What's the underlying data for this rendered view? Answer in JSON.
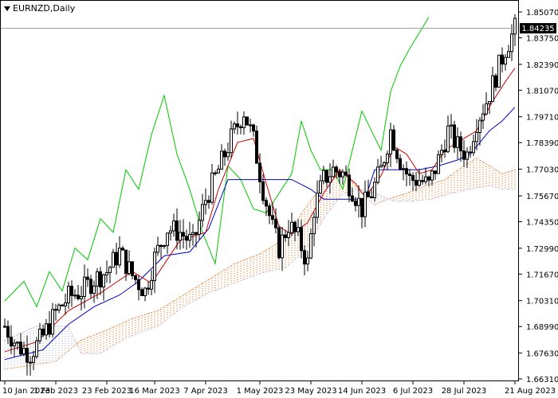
{
  "header": {
    "symbol_label": "EURNZD,Daily"
  },
  "colors": {
    "background": "#ffffff",
    "candle": "#000000",
    "chikou": "#00c800",
    "tenkan": "#cc0000",
    "kijun": "#0000cc",
    "cloud_bull": "#e06000",
    "cloud_bear": "#a0a0c8",
    "price_line": "#a0a0a0"
  },
  "chart_data": {
    "type": "candlestick",
    "title": "EURNZD,Daily",
    "current_price": 1.84235,
    "current_price_label": "1.84235",
    "ylim": [
      1.6631,
      1.8507
    ],
    "y_ticks": [
      "1.85070",
      "1.83750",
      "1.82390",
      "1.81070",
      "1.79710",
      "1.78390",
      "1.77030",
      "1.75670",
      "1.74350",
      "1.72990",
      "1.71670",
      "1.70310",
      "1.68990",
      "1.67630",
      "1.66310"
    ],
    "x_tick_labels": [
      "10 Jan 2023",
      "1 Feb 2023",
      "23 Feb 2023",
      "16 Mar 2023",
      "7 Apr 2023",
      "1 May 2023",
      "23 May 2023",
      "14 Jun 2023",
      "6 Jul 2023",
      "28 Jul 2023",
      "21 Aug 2023"
    ],
    "x_tick_index": [
      0,
      16,
      32,
      47,
      63,
      80,
      96,
      112,
      128,
      144,
      160
    ],
    "close_anchors": [
      [
        0,
        1.69
      ],
      [
        4,
        1.68
      ],
      [
        8,
        1.676
      ],
      [
        12,
        1.685
      ],
      [
        16,
        1.697
      ],
      [
        20,
        1.705
      ],
      [
        24,
        1.708
      ],
      [
        28,
        1.714
      ],
      [
        32,
        1.718
      ],
      [
        36,
        1.728
      ],
      [
        40,
        1.716
      ],
      [
        44,
        1.708
      ],
      [
        47,
        1.725
      ],
      [
        51,
        1.74
      ],
      [
        55,
        1.738
      ],
      [
        59,
        1.732
      ],
      [
        63,
        1.755
      ],
      [
        67,
        1.77
      ],
      [
        71,
        1.786
      ],
      [
        75,
        1.8
      ],
      [
        78,
        1.785
      ],
      [
        81,
        1.76
      ],
      [
        84,
        1.74
      ],
      [
        86,
        1.73
      ],
      [
        89,
        1.742
      ],
      [
        92,
        1.735
      ],
      [
        95,
        1.722
      ],
      [
        97,
        1.75
      ],
      [
        100,
        1.765
      ],
      [
        103,
        1.77
      ],
      [
        106,
        1.768
      ],
      [
        109,
        1.76
      ],
      [
        112,
        1.75
      ],
      [
        115,
        1.758
      ],
      [
        118,
        1.77
      ],
      [
        121,
        1.79
      ],
      [
        124,
        1.775
      ],
      [
        127,
        1.765
      ],
      [
        130,
        1.765
      ],
      [
        133,
        1.762
      ],
      [
        136,
        1.775
      ],
      [
        139,
        1.79
      ],
      [
        142,
        1.782
      ],
      [
        145,
        1.778
      ],
      [
        148,
        1.795
      ],
      [
        151,
        1.805
      ],
      [
        154,
        1.818
      ],
      [
        157,
        1.832
      ],
      [
        160,
        1.842
      ]
    ],
    "indicators": {
      "tenkan": [
        [
          0,
          1.677
        ],
        [
          10,
          1.682
        ],
        [
          20,
          1.698
        ],
        [
          30,
          1.707
        ],
        [
          40,
          1.718
        ],
        [
          46,
          1.712
        ],
        [
          55,
          1.734
        ],
        [
          63,
          1.738
        ],
        [
          67,
          1.76
        ],
        [
          73,
          1.784
        ],
        [
          78,
          1.786
        ],
        [
          82,
          1.763
        ],
        [
          86,
          1.741
        ],
        [
          90,
          1.737
        ],
        [
          95,
          1.743
        ],
        [
          100,
          1.758
        ],
        [
          105,
          1.77
        ],
        [
          110,
          1.763
        ],
        [
          113,
          1.756
        ],
        [
          118,
          1.767
        ],
        [
          122,
          1.782
        ],
        [
          126,
          1.778
        ],
        [
          130,
          1.768
        ],
        [
          134,
          1.77
        ],
        [
          138,
          1.78
        ],
        [
          143,
          1.785
        ],
        [
          148,
          1.79
        ],
        [
          153,
          1.805
        ],
        [
          157,
          1.815
        ],
        [
          160,
          1.822
        ]
      ],
      "kijun": [
        [
          0,
          1.673
        ],
        [
          12,
          1.678
        ],
        [
          20,
          1.691
        ],
        [
          28,
          1.7
        ],
        [
          36,
          1.706
        ],
        [
          42,
          1.713
        ],
        [
          50,
          1.726
        ],
        [
          58,
          1.728
        ],
        [
          64,
          1.74
        ],
        [
          70,
          1.765
        ],
        [
          80,
          1.765
        ],
        [
          90,
          1.765
        ],
        [
          96,
          1.76
        ],
        [
          100,
          1.755
        ],
        [
          108,
          1.755
        ],
        [
          113,
          1.755
        ],
        [
          116,
          1.77
        ],
        [
          122,
          1.77
        ],
        [
          130,
          1.77
        ],
        [
          136,
          1.772
        ],
        [
          142,
          1.775
        ],
        [
          146,
          1.778
        ],
        [
          152,
          1.79
        ],
        [
          156,
          1.795
        ],
        [
          160,
          1.802
        ]
      ],
      "chikou": [
        [
          0,
          1.703
        ],
        [
          6,
          1.713
        ],
        [
          10,
          1.7
        ],
        [
          14,
          1.718
        ],
        [
          18,
          1.708
        ],
        [
          22,
          1.73
        ],
        [
          26,
          1.724
        ],
        [
          30,
          1.745
        ],
        [
          34,
          1.738
        ],
        [
          38,
          1.77
        ],
        [
          42,
          1.76
        ],
        [
          46,
          1.788
        ],
        [
          50,
          1.808
        ],
        [
          54,
          1.778
        ],
        [
          58,
          1.76
        ],
        [
          62,
          1.738
        ],
        [
          66,
          1.722
        ],
        [
          70,
          1.772
        ],
        [
          74,
          1.765
        ],
        [
          78,
          1.75
        ],
        [
          82,
          1.748
        ],
        [
          86,
          1.758
        ],
        [
          90,
          1.768
        ],
        [
          93,
          1.795
        ],
        [
          96,
          1.78
        ],
        [
          99,
          1.77
        ],
        [
          103,
          1.77
        ],
        [
          106,
          1.76
        ],
        [
          109,
          1.78
        ],
        [
          112,
          1.8
        ],
        [
          115,
          1.79
        ],
        [
          118,
          1.78
        ],
        [
          121,
          1.81
        ],
        [
          124,
          1.823
        ],
        [
          127,
          1.832
        ],
        [
          130,
          1.84
        ],
        [
          133,
          1.848
        ]
      ],
      "cloud_upper": [
        [
          0,
          1.668
        ],
        [
          16,
          1.672
        ],
        [
          24,
          1.683
        ],
        [
          32,
          1.688
        ],
        [
          40,
          1.694
        ],
        [
          48,
          1.698
        ],
        [
          56,
          1.706
        ],
        [
          64,
          1.714
        ],
        [
          72,
          1.722
        ],
        [
          80,
          1.727
        ],
        [
          88,
          1.735
        ],
        [
          94,
          1.75
        ],
        [
          100,
          1.763
        ],
        [
          106,
          1.769
        ],
        [
          112,
          1.758
        ],
        [
          116,
          1.752
        ],
        [
          120,
          1.755
        ],
        [
          126,
          1.758
        ],
        [
          132,
          1.762
        ],
        [
          138,
          1.765
        ],
        [
          144,
          1.772
        ],
        [
          148,
          1.776
        ],
        [
          152,
          1.772
        ],
        [
          156,
          1.768
        ],
        [
          160,
          1.77
        ]
      ],
      "cloud_lower": [
        [
          0,
          1.683
        ],
        [
          10,
          1.69
        ],
        [
          20,
          1.69
        ],
        [
          24,
          1.676
        ],
        [
          30,
          1.676
        ],
        [
          38,
          1.684
        ],
        [
          48,
          1.69
        ],
        [
          56,
          1.7
        ],
        [
          64,
          1.707
        ],
        [
          72,
          1.712
        ],
        [
          80,
          1.717
        ],
        [
          88,
          1.72
        ],
        [
          94,
          1.728
        ],
        [
          100,
          1.745
        ],
        [
          106,
          1.758
        ],
        [
          112,
          1.76
        ],
        [
          116,
          1.758
        ],
        [
          122,
          1.754
        ],
        [
          128,
          1.754
        ],
        [
          134,
          1.755
        ],
        [
          140,
          1.758
        ],
        [
          146,
          1.76
        ],
        [
          152,
          1.762
        ],
        [
          156,
          1.76
        ],
        [
          160,
          1.76
        ]
      ]
    }
  }
}
